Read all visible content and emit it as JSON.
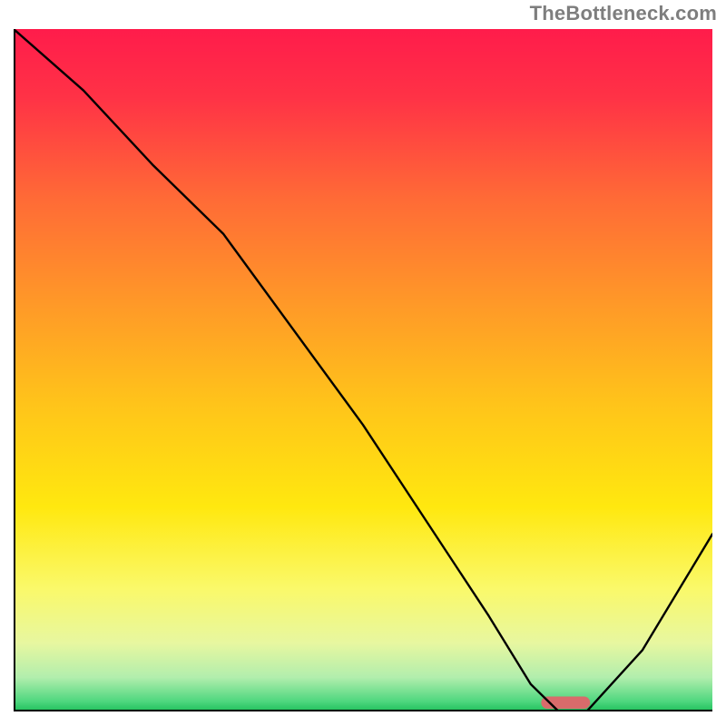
{
  "credit": "TheBottleneck.com",
  "chart_data": {
    "type": "line",
    "title": "",
    "xlabel": "",
    "ylabel": "",
    "xlim": [
      0,
      100
    ],
    "ylim": [
      0,
      100
    ],
    "grid": false,
    "legend": false,
    "series": [
      {
        "name": "curve",
        "x": [
          0,
          10,
          20,
          30,
          50,
          68,
          74,
          78,
          82,
          90,
          100
        ],
        "y": [
          100,
          91,
          80,
          70,
          42,
          14,
          4,
          0,
          0,
          9,
          26
        ]
      }
    ],
    "marker": {
      "name": "optimum",
      "x": 79,
      "y": 0,
      "width": 7,
      "height": 1.8,
      "color": "#d86b6b"
    },
    "gradient_stops": [
      {
        "offset": 0.0,
        "color": "#ff1c4b"
      },
      {
        "offset": 0.1,
        "color": "#ff3246"
      },
      {
        "offset": 0.25,
        "color": "#ff6b36"
      },
      {
        "offset": 0.4,
        "color": "#ff9828"
      },
      {
        "offset": 0.55,
        "color": "#ffc41a"
      },
      {
        "offset": 0.7,
        "color": "#ffe80f"
      },
      {
        "offset": 0.82,
        "color": "#faf96a"
      },
      {
        "offset": 0.9,
        "color": "#e7f7a0"
      },
      {
        "offset": 0.95,
        "color": "#b2eead"
      },
      {
        "offset": 0.985,
        "color": "#4fd77f"
      },
      {
        "offset": 1.0,
        "color": "#1fc05b"
      }
    ],
    "axis_color": "#000000",
    "curve_color": "#000000",
    "curve_width": 2.4
  }
}
